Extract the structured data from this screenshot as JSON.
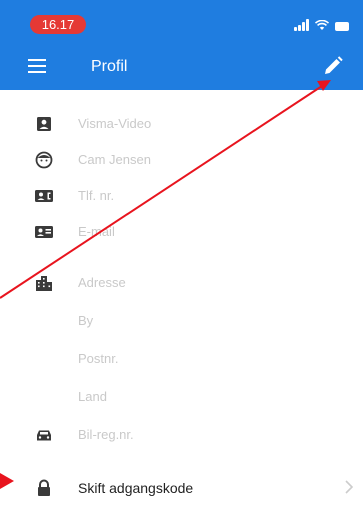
{
  "status_bar": {
    "time": "16.17",
    "icons": [
      "signal-icon",
      "wifi-icon",
      "battery-icon"
    ]
  },
  "app_bar": {
    "title": "Profil",
    "menu_icon": "menu-icon",
    "edit_icon": "edit-pencil-icon"
  },
  "profile_fields": [
    {
      "icon": "person-badge-icon",
      "placeholder": "Visma-Video"
    },
    {
      "icon": "face-icon",
      "placeholder": "Cam Jensen"
    },
    {
      "icon": "contact-phone-icon",
      "placeholder": "Tlf. nr."
    },
    {
      "icon": "contact-card-icon",
      "placeholder": "E-mail"
    },
    {
      "icon": "building-icon",
      "placeholder": "Adresse"
    },
    {
      "icon": "",
      "placeholder": "By"
    },
    {
      "icon": "",
      "placeholder": "Postnr."
    },
    {
      "icon": "",
      "placeholder": "Land"
    },
    {
      "icon": "car-icon",
      "placeholder": "Bil-reg.nr."
    }
  ],
  "change_password": {
    "icon": "lock-icon",
    "label": "Skift adgangskode"
  },
  "annotation_color": "#e8141e",
  "theme": {
    "primary": "#1f7de0",
    "status_red": "#e53935",
    "field_icon": "#3a3a3a",
    "placeholder_text": "#c9c9c9"
  }
}
